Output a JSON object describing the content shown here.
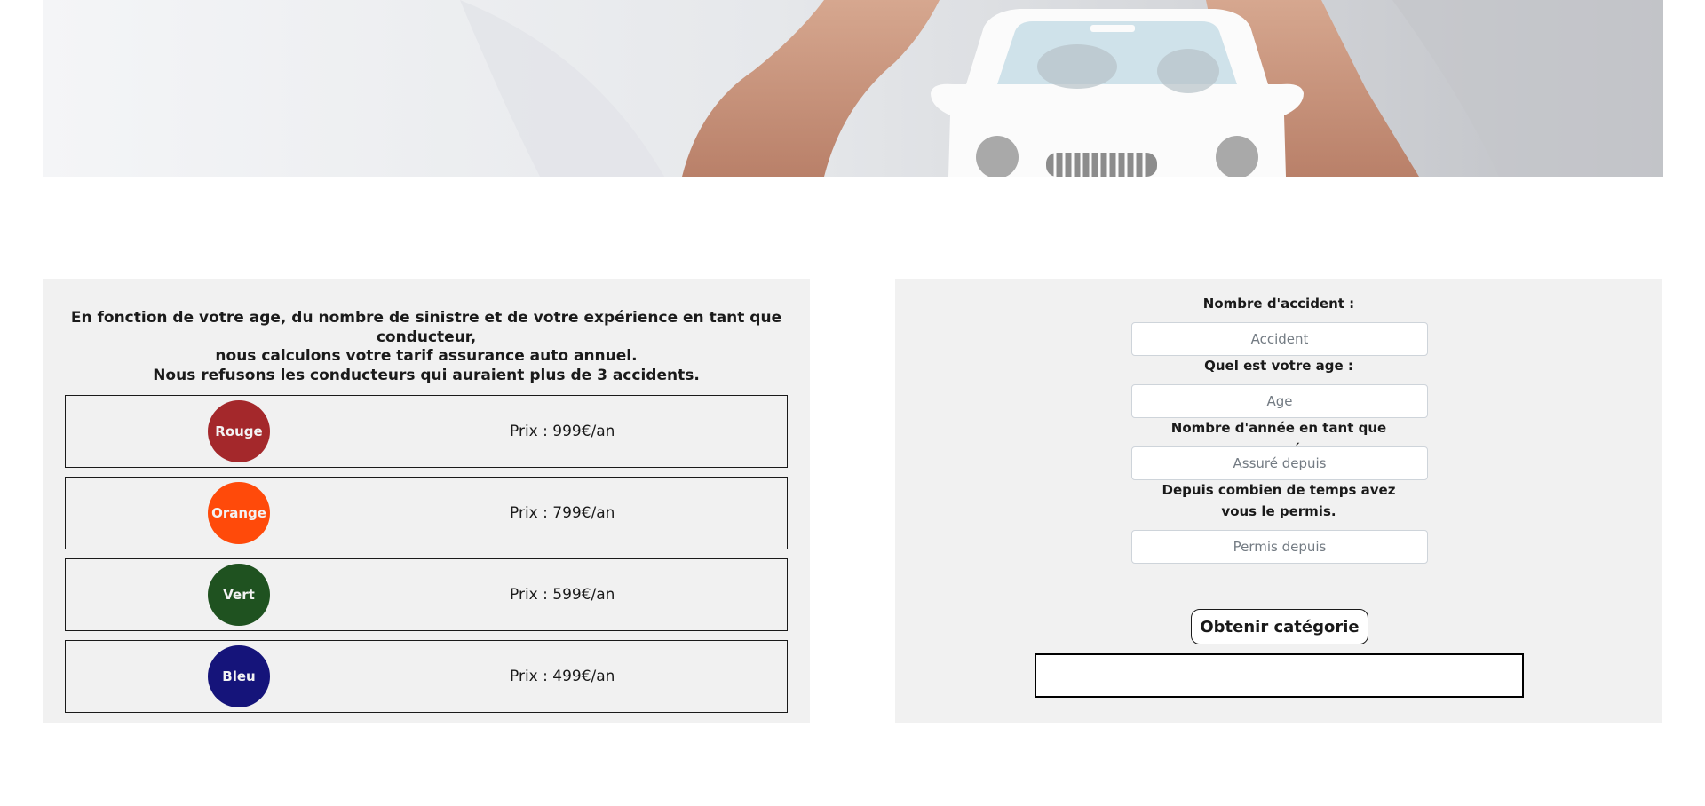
{
  "hero": {
    "image": "hands-protecting-paper-car"
  },
  "info": {
    "intro_line1": "En fonction de votre age, du nombre de sinistre et de votre expérience en tant que conducteur,",
    "intro_line2": "nous calculons votre tarif assurance auto annuel.",
    "intro_line3": "Nous refusons les conducteurs qui auraient plus de 3 accidents."
  },
  "categories": [
    {
      "label": "Rouge",
      "price": "Prix : 999€/an",
      "color": "#a4282b"
    },
    {
      "label": "Orange",
      "price": "Prix : 799€/an",
      "color": "#ff4a0a"
    },
    {
      "label": "Vert",
      "price": "Prix : 599€/an",
      "color": "#1f5220"
    },
    {
      "label": "Bleu",
      "price": "Prix : 499€/an",
      "color": "#15147a"
    }
  ],
  "form": {
    "accident_label": "Nombre d'accident :",
    "accident_placeholder": "Accident",
    "age_label": "Quel est votre age :",
    "age_placeholder": "Age",
    "assure_label": "Nombre d'année en tant que assuré:",
    "assure_placeholder": "Assuré depuis",
    "permis_label": "Depuis combien de temps avez vous le permis.",
    "permis_placeholder": "Permis depuis",
    "submit_label": "Obtenir catégorie",
    "result": ""
  }
}
